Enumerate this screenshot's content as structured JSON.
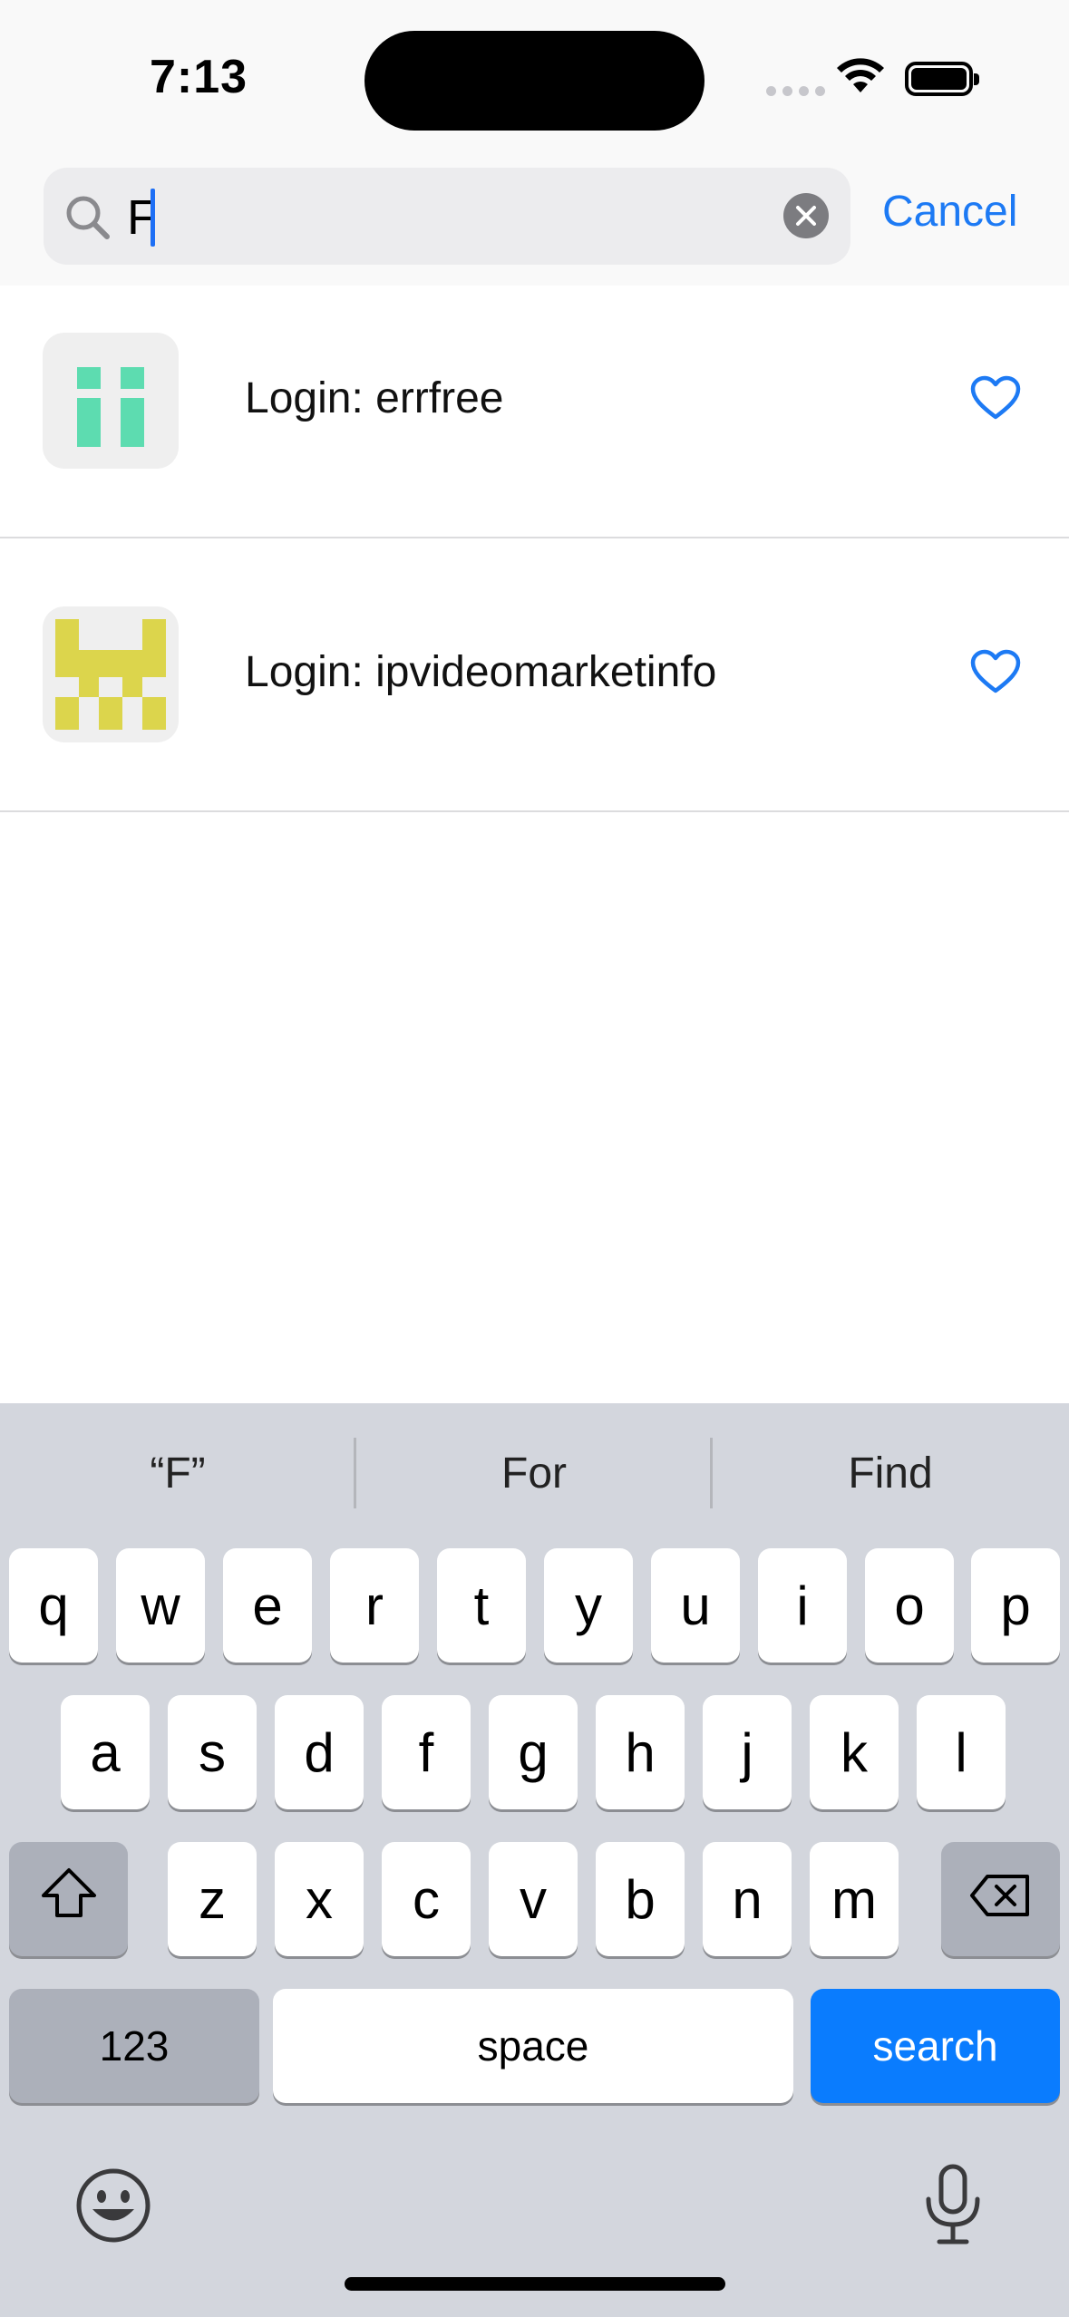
{
  "status_bar": {
    "time": "7:13"
  },
  "search": {
    "query": "F",
    "cancel_label": "Cancel"
  },
  "results": [
    {
      "label": "Login: errfree",
      "avatar_color": "#5ddcb0"
    },
    {
      "label": "Login: ipvideomarketinfo",
      "avatar_color": "#dcd54c"
    }
  ],
  "keyboard": {
    "suggestions": [
      "“F”",
      "For",
      "Find"
    ],
    "row1": [
      "q",
      "w",
      "e",
      "r",
      "t",
      "y",
      "u",
      "i",
      "o",
      "p"
    ],
    "row2": [
      "a",
      "s",
      "d",
      "f",
      "g",
      "h",
      "j",
      "k",
      "l"
    ],
    "row3": [
      "z",
      "x",
      "c",
      "v",
      "b",
      "n",
      "m"
    ],
    "numbers_label": "123",
    "space_label": "space",
    "search_label": "search"
  },
  "colors": {
    "accent": "#1d7af4",
    "search_key": "#0a7cfe",
    "keyboard_bg": "#d3d6dd"
  }
}
